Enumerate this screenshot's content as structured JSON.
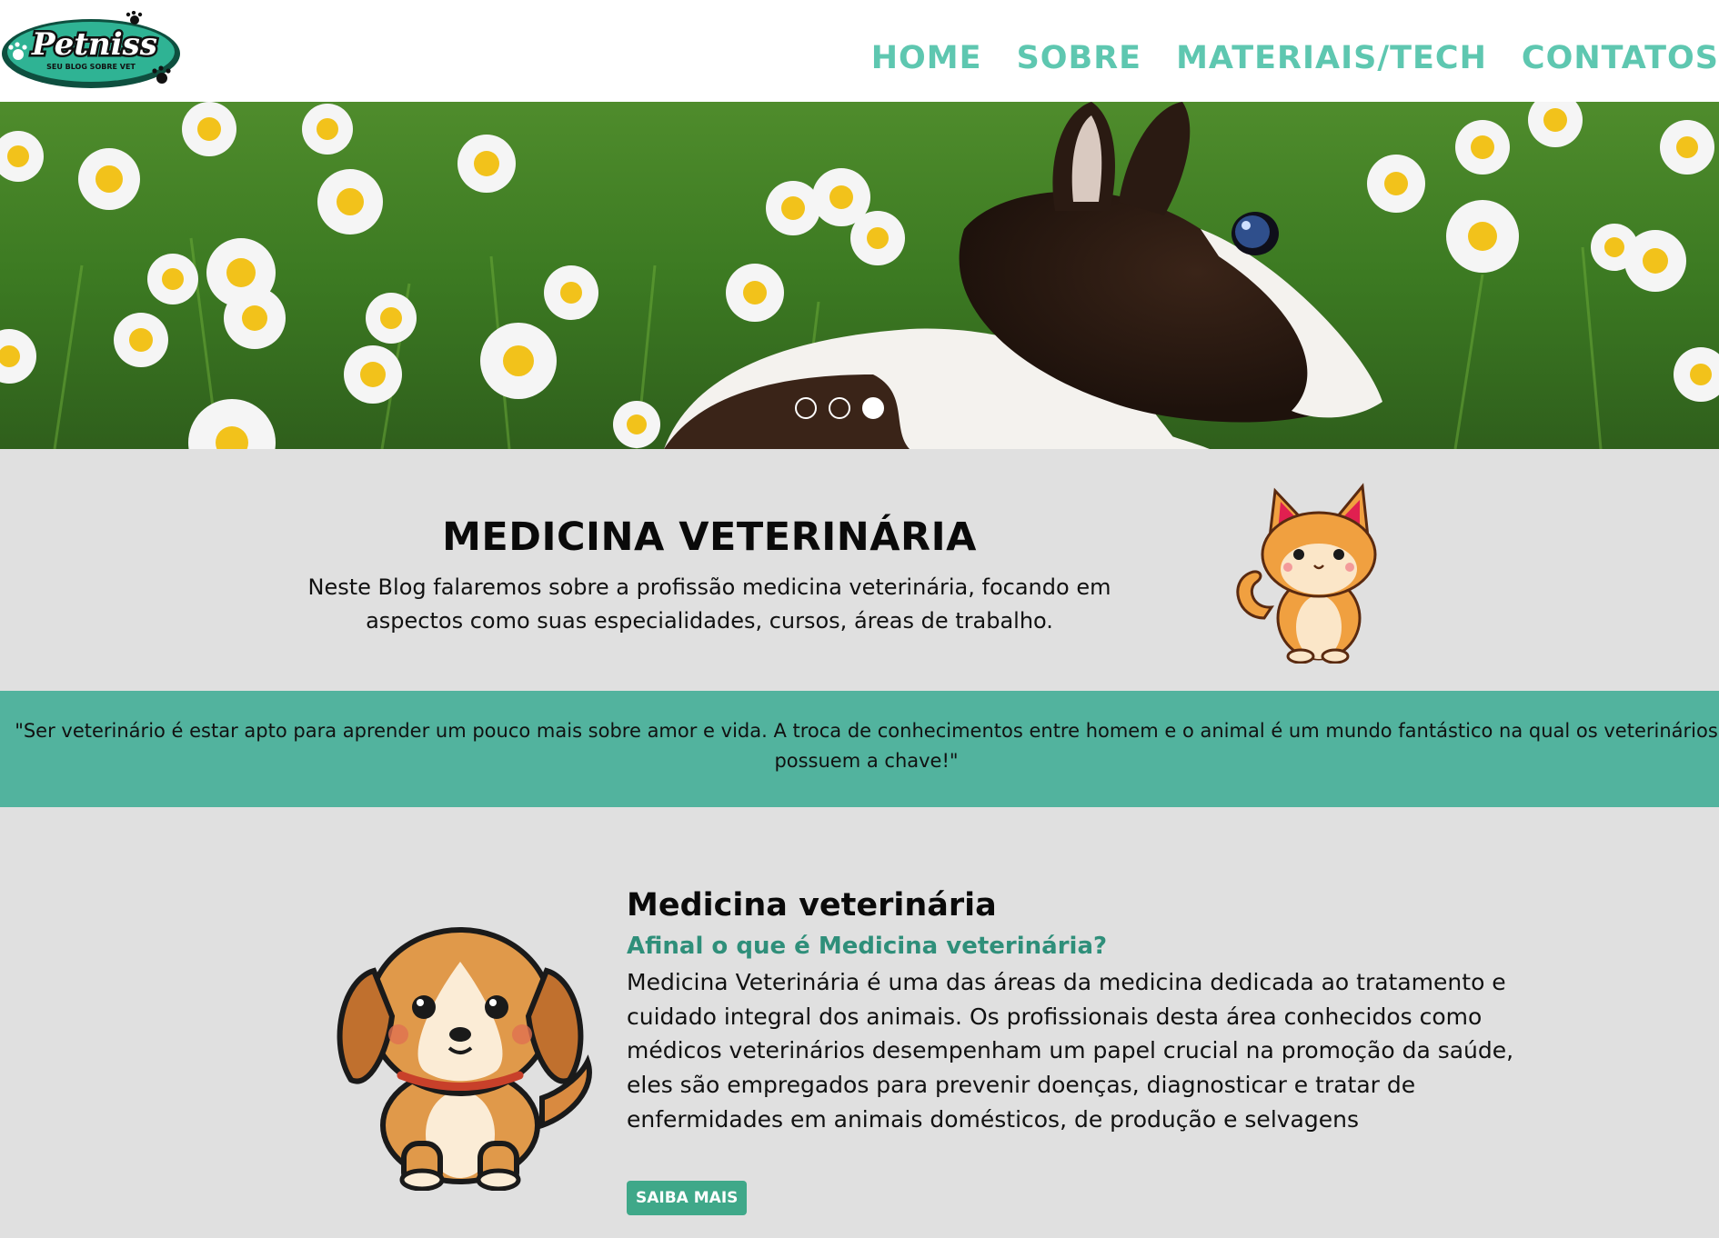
{
  "header": {
    "logo_text": "Petniss",
    "logo_tagline": "SEU BLOG SOBRE VET",
    "nav": [
      "HOME",
      "SOBRE",
      "MATERIAIS/TECH",
      "CONTATOS"
    ]
  },
  "hero": {
    "slide_count": 3,
    "active_slide": 3
  },
  "intro": {
    "title": "MEDICINA VETERINÁRIA",
    "text": "Neste Blog falaremos sobre a profissão medicina veterinária, focando em aspectos como suas especialidades, cursos, áreas de trabalho."
  },
  "quote": {
    "text": "\"Ser veterinário é estar apto para aprender um pouco mais sobre amor e vida. A troca de conhecimentos entre homem e o animal é um mundo fantástico na qual os veterinários possuem a chave!\""
  },
  "article": {
    "title": "Medicina veterinária",
    "subtitle": "Afinal o que é Medicina veterinária?",
    "body": "Medicina Veterinária é uma das áreas da medicina dedicada ao tratamento e cuidado integral dos animais. Os profissionais desta área conhecidos como médicos veterinários desempenham um papel crucial na promoção da saúde, eles são empregados para prevenir doenças, diagnosticar e tratar de enfermidades em animais domésticos, de produção e selvagens",
    "button_label": "SAIBA MAIS"
  },
  "colors": {
    "accent": "#5ec7b0",
    "banner": "#52b39e",
    "subtitle": "#2f8f7a",
    "button": "#3fa889",
    "background": "#e0e0e0"
  }
}
